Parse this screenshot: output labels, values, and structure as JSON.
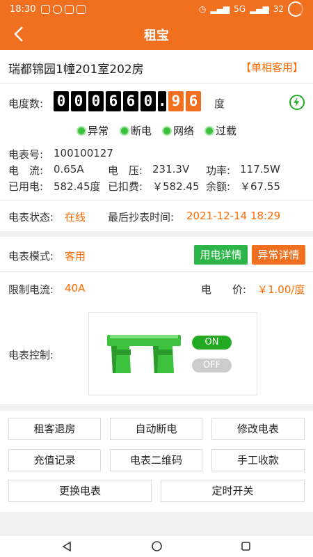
{
  "status_bar": {
    "time": "18:30",
    "network": "5G",
    "battery": "32"
  },
  "header": {
    "title": "租宝"
  },
  "room": {
    "name": "瑞都锦园1幢201室202房",
    "tag": "【单相客用】"
  },
  "meter": {
    "reading_label": "电度数:",
    "integer_digits": [
      "0",
      "0",
      "0",
      "6",
      "6",
      "0"
    ],
    "dot": ".",
    "decimal_digits": [
      "9",
      "6"
    ],
    "unit": "度",
    "indicators": [
      "异常",
      "断电",
      "网络",
      "过载"
    ],
    "meter_no_label": "电表号:",
    "meter_no": "100100127",
    "current_label": "电　流:",
    "current": "0.65A",
    "voltage_label": "电　压:",
    "voltage": "231.3V",
    "power_label": "功率:",
    "power": "117.5W",
    "used_label": "已用电:",
    "used": "582.45度",
    "deducted_label": "已扣费:",
    "deducted": "￥582.45",
    "balance_label": "余额:",
    "balance": "￥67.55"
  },
  "meter_status": {
    "label": "电表状态:",
    "value": "在线",
    "last_read_label": "最后抄表时间:",
    "last_read": "2021-12-14 18:29"
  },
  "mode": {
    "label": "电表模式:",
    "value": "客用",
    "usage_button": "用电详情",
    "abnormal_button": "异常详情"
  },
  "limits": {
    "current_label": "限制电流:",
    "current_value": "40A",
    "price_label": "电　　价:",
    "price_value": "￥1.00/度",
    "control_label": "电表控制:",
    "on_label": "ON",
    "off_label": "OFF"
  },
  "actions": {
    "row1": [
      "租客退房",
      "自动断电",
      "修改电表"
    ],
    "row2": [
      "充值记录",
      "电表二维码",
      "手工收款"
    ],
    "row3": [
      "更换电表",
      "定时开关"
    ]
  },
  "colors": {
    "brand": "#f07020",
    "accent_text": "#ff6a00",
    "green": "#2db54a"
  }
}
